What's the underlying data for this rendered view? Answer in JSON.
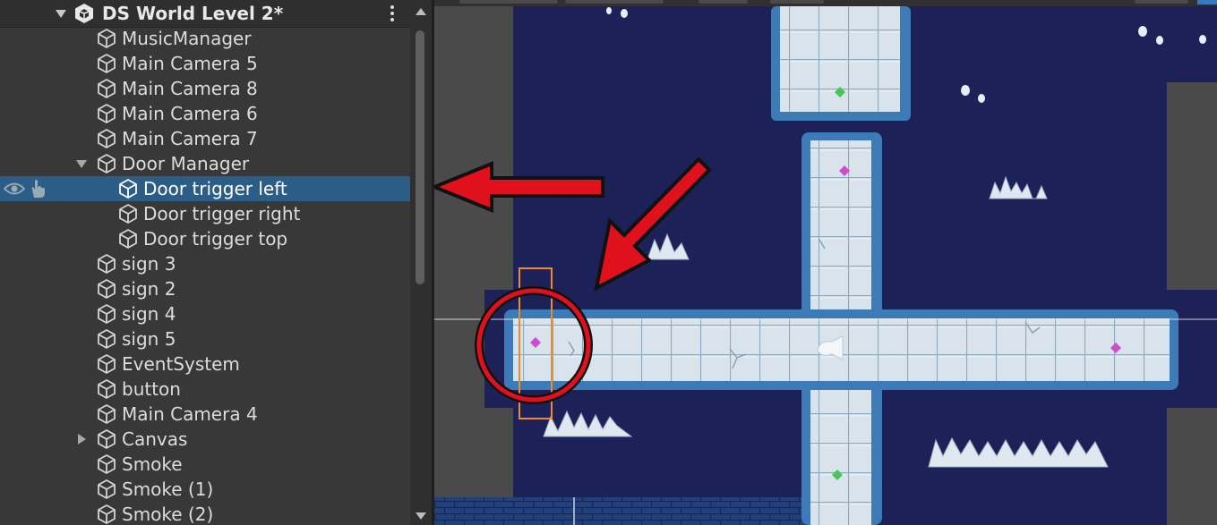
{
  "hierarchy": {
    "scene_name": "DS World Level 2*",
    "items": [
      {
        "label": "MusicManager"
      },
      {
        "label": "Main Camera 5"
      },
      {
        "label": "Main Camera 8"
      },
      {
        "label": "Main Camera 6"
      },
      {
        "label": "Main Camera 7"
      },
      {
        "label": "Door Manager"
      },
      {
        "label": "Door trigger left"
      },
      {
        "label": "Door trigger right"
      },
      {
        "label": "Door trigger top"
      },
      {
        "label": "sign 3"
      },
      {
        "label": "sign 2"
      },
      {
        "label": "sign 4"
      },
      {
        "label": "sign 5"
      },
      {
        "label": "EventSystem"
      },
      {
        "label": "button"
      },
      {
        "label": "Main Camera 4"
      },
      {
        "label": "Canvas"
      },
      {
        "label": "Smoke"
      },
      {
        "label": "Smoke (1)"
      },
      {
        "label": "Smoke (2)"
      }
    ]
  },
  "icons": {
    "unity": "unity-logo-icon",
    "gameobject": "gameobject-cube-icon",
    "visibility": "eye-icon",
    "pickable": "hand-icon",
    "menu": "kebab-menu-icon"
  },
  "colors": {
    "selection": "#2c5d87",
    "scene_background": "#1c2257",
    "annotation": "#e0101c",
    "selection_outline": "#f08a24"
  }
}
